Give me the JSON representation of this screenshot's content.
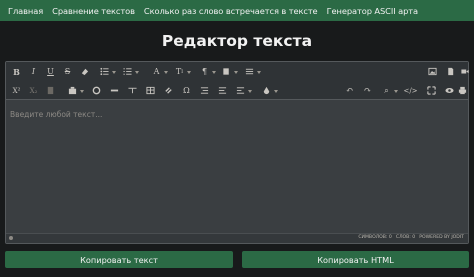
{
  "nav": {
    "links": [
      "Главная",
      "Сравнение текстов",
      "Сколько раз слово встречается в тексте",
      "Генератор ASCII арта"
    ]
  },
  "page_title": "Редактор текста",
  "editor": {
    "placeholder": "Введите любой текст...",
    "status": {
      "chars": "Символов: 0",
      "words": "Слов: 0",
      "powered": "POWERED BY JODIT"
    }
  },
  "toolbar": {
    "row1_icons": [
      "bold-icon",
      "italic-icon",
      "underline-icon",
      "strikethrough-icon",
      "eraser-icon",
      "unordered-list-icon",
      "ordered-list-icon",
      "font-icon",
      "font-size-icon",
      "paragraph-icon",
      "classes-icon",
      "line-height-icon",
      "image-icon",
      "file-icon",
      "video-icon"
    ],
    "row2_icons": [
      "superscript-icon",
      "subscript-icon",
      "spellcheck-icon",
      "select-all-icon",
      "horizontal-rule-icon",
      "table-icon",
      "link-icon",
      "special-char-icon",
      "indent-icon",
      "outdent-icon",
      "align-icon",
      "brush-icon",
      "undo-icon",
      "redo-icon",
      "find-icon",
      "source-icon",
      "fullsize-icon",
      "preview-icon",
      "print-icon"
    ]
  },
  "buttons": {
    "copy_text": "Копировать текст",
    "copy_html": "Копировать HTML"
  }
}
